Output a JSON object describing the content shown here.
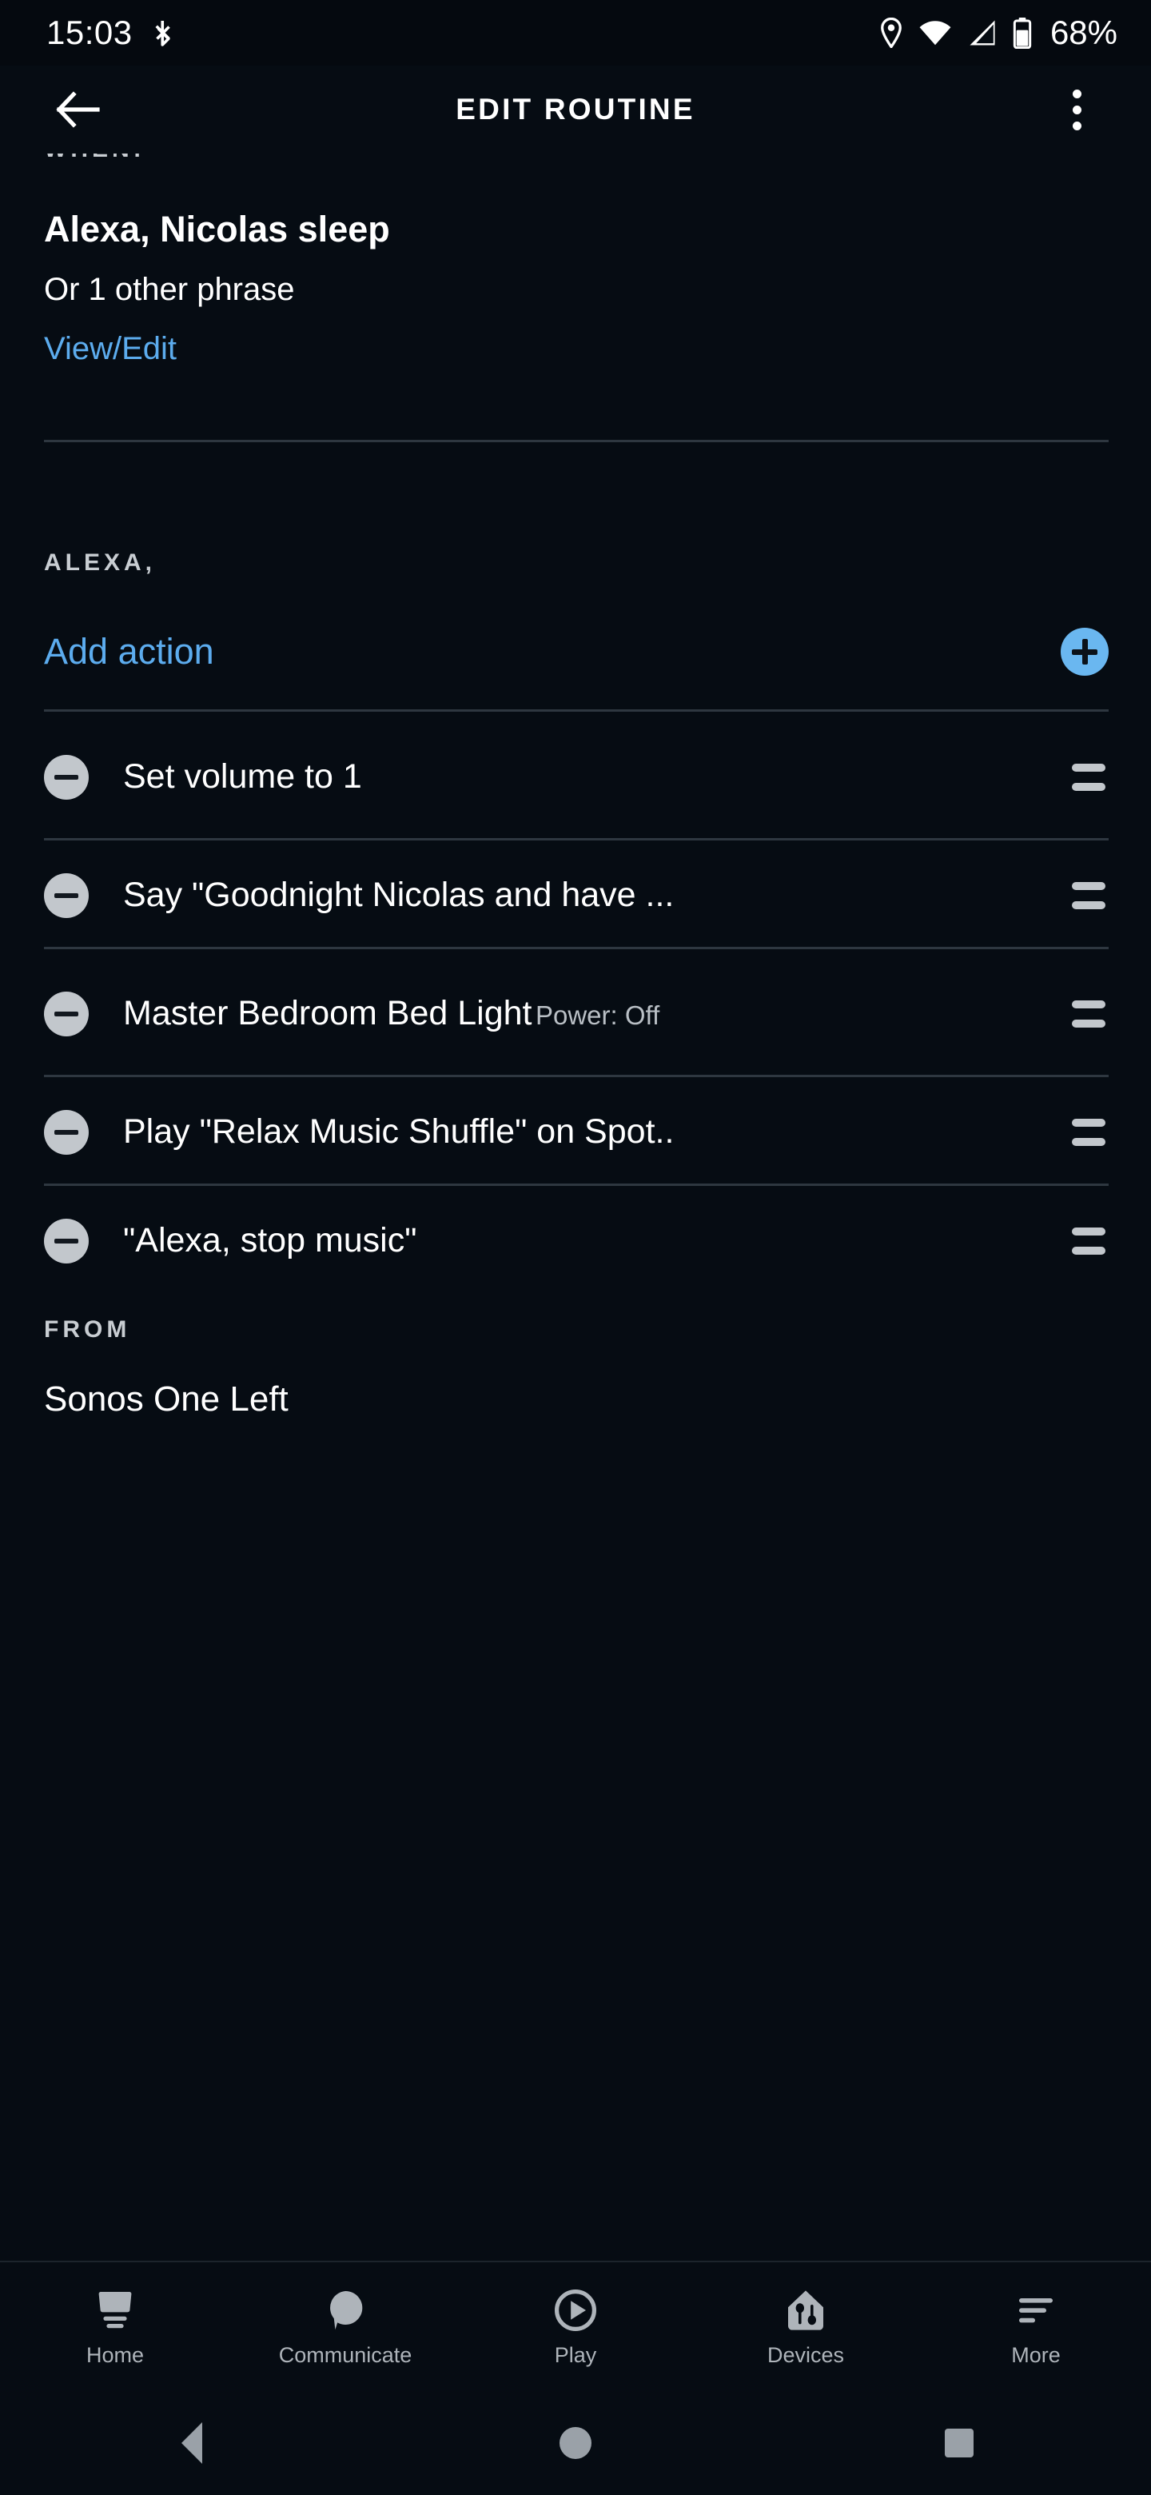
{
  "status_bar": {
    "time": "15:03",
    "bluetooth_icon": "bluetooth-disabled-icon",
    "location_icon": "location-pin-icon",
    "wifi_icon": "wifi-icon",
    "signal_icon": "cellular-signal-icon",
    "battery_icon": "battery-icon",
    "battery_text": "68%"
  },
  "app_bar": {
    "back_icon": "back-arrow-icon",
    "title": "EDIT ROUTINE",
    "overflow_icon": "overflow-menu-icon"
  },
  "trigger": {
    "section_label": "WHEN:",
    "phrase": "Alexa, Nicolas sleep",
    "other_phrases": "Or 1 other phrase",
    "view_edit_link": "View/Edit"
  },
  "actions_section": {
    "label": "ALEXA,",
    "add_action_label": "Add action",
    "add_icon": "plus-circle-icon",
    "remove_icon": "minus-circle-icon",
    "drag_icon": "drag-handle-icon",
    "items": [
      {
        "title": "Set volume to 1",
        "subtitle": ""
      },
      {
        "title": "Say \"Goodnight Nicolas and have ...",
        "subtitle": ""
      },
      {
        "title": "Master Bedroom Bed Light",
        "subtitle": "Power: Off"
      },
      {
        "title": "Play \"Relax Music Shuffle\" on Spot..",
        "subtitle": ""
      },
      {
        "title": "\"Alexa, stop music\"",
        "subtitle": ""
      }
    ]
  },
  "from_section": {
    "label": "FROM",
    "device": "Sonos One Left"
  },
  "bottom_nav": {
    "items": [
      {
        "label": "Home",
        "icon": "echo-device-icon"
      },
      {
        "label": "Communicate",
        "icon": "speech-bubble-icon"
      },
      {
        "label": "Play",
        "icon": "play-circle-icon"
      },
      {
        "label": "Devices",
        "icon": "home-devices-icon"
      },
      {
        "label": "More",
        "icon": "more-lines-icon"
      }
    ]
  },
  "system_nav": {
    "back": "back-nav-button",
    "home": "home-nav-button",
    "recents": "recents-nav-button"
  },
  "colors": {
    "background": "#060c13",
    "accent_link": "#5cacee",
    "accent_button": "#6ab7f0",
    "text_primary": "#ffffff",
    "text_secondary": "#b9bfc5",
    "divider": "#2e3740"
  }
}
